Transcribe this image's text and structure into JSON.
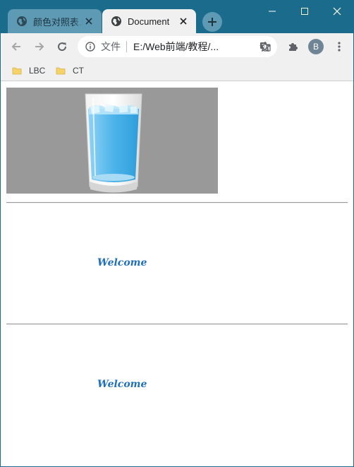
{
  "window": {
    "tabs": [
      {
        "title": "颜色对照表.h",
        "active": false
      },
      {
        "title": "Document",
        "active": true
      }
    ],
    "controls": {
      "minimize": "minimize-icon",
      "maximize": "maximize-icon",
      "close": "close-icon"
    }
  },
  "toolbar": {
    "omnibox": {
      "scheme_label": "文件",
      "url": "E:/Web前端/教程/..."
    },
    "avatar_letter": "B"
  },
  "bookmarks": [
    {
      "label": "LBC"
    },
    {
      "label": "CT"
    }
  ],
  "page": {
    "image": {
      "alt": "glass-of-water",
      "background": "#999999"
    },
    "texts": [
      {
        "text": "Welcome"
      },
      {
        "text": "Welcome"
      }
    ]
  },
  "colors": {
    "titlebar": "#1b6b8d",
    "inactive_tab": "#5e9ab4",
    "toolbar": "#f0f0f0",
    "text_blue": "#1f6fc0"
  }
}
